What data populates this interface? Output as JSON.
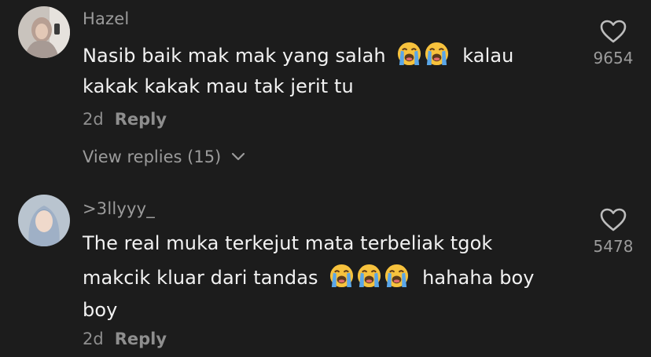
{
  "comments": [
    {
      "username": "Hazel",
      "text_lines": [
        {
          "before": "Nasib baik mak mak yang salah",
          "emojis": [
            "loudly-crying-face",
            "loudly-crying-face"
          ],
          "after": "kalau"
        },
        {
          "text": "kakak kakak mau tak jerit tu"
        }
      ],
      "age": "2d",
      "reply_label": "Reply",
      "view_replies_label": "View replies (15)",
      "like_count": "9654"
    },
    {
      "username": ">3llyyy_",
      "text_lines": [
        {
          "text": "The real muka terkejut mata terbeliak tgok"
        },
        {
          "before": "makcik kluar dari tandas",
          "emojis": [
            "loudly-crying-face",
            "loudly-crying-face",
            "loudly-crying-face"
          ],
          "after": "hahaha boy"
        },
        {
          "text": "boy"
        }
      ],
      "age": "2d",
      "reply_label": "Reply",
      "like_count": "5478"
    }
  ],
  "colors": {
    "background": "#1c1c1c",
    "text_primary": "#f2f2f2",
    "text_secondary": "#9b9b9b",
    "emoji_face": "#f7c23d",
    "emoji_tear": "#5aa6e8"
  },
  "icons": {
    "like": "heart-outline-icon",
    "expand": "chevron-down-icon",
    "emoji": "loudly-crying-face"
  }
}
